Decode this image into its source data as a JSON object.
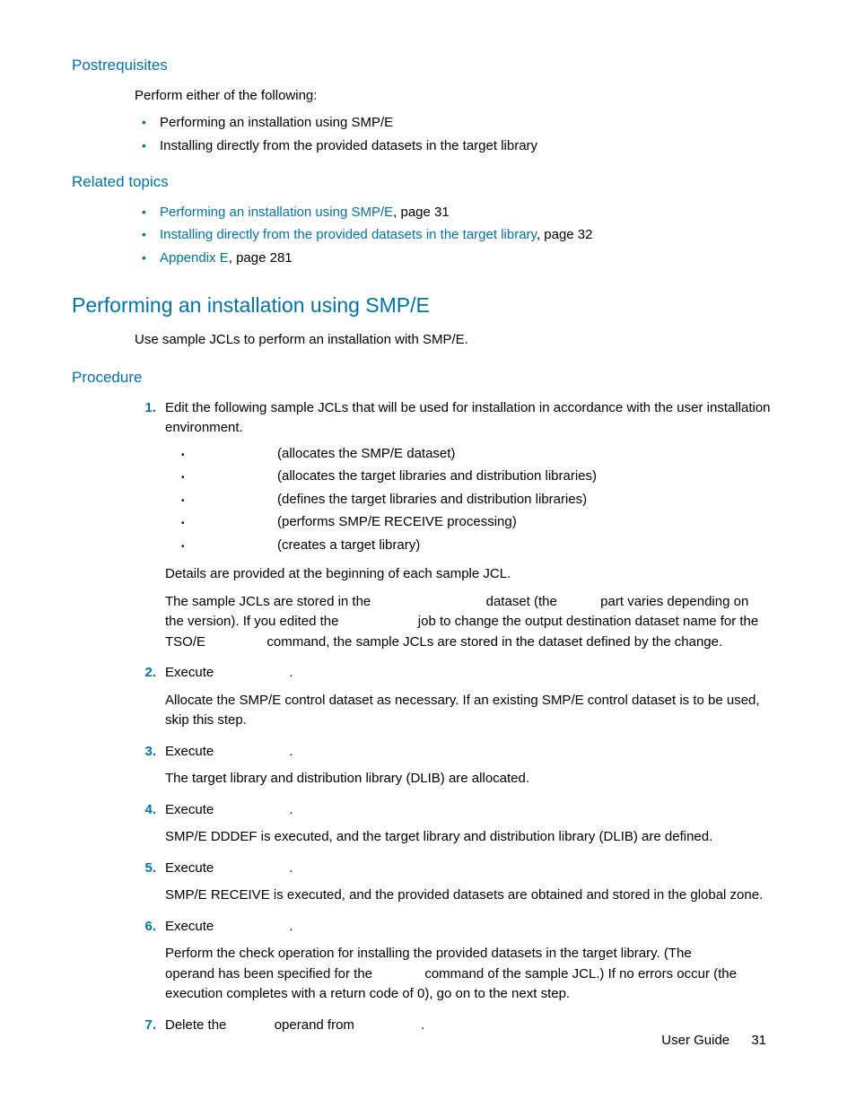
{
  "postreq": {
    "heading": "Postrequisites",
    "intro": "Perform either of the following:",
    "items": [
      "Performing an installation using SMP/E",
      "Installing directly from the provided datasets in the target library"
    ]
  },
  "related": {
    "heading": "Related topics",
    "items": [
      {
        "link": "Performing an installation using SMP/E",
        "suffix": ", page 31"
      },
      {
        "link": "Installing directly from the provided datasets in the target library",
        "suffix": ", page 32"
      },
      {
        "link": "Appendix E",
        "suffix": ", page 281"
      }
    ]
  },
  "main": {
    "heading": "Performing an installation using SMP/E",
    "intro": "Use sample JCLs to perform an installation with SMP/E."
  },
  "procedure": {
    "heading": "Procedure",
    "step1": {
      "text": "Edit the following sample JCLs that will be used for installation in accordance with the user installation environment.",
      "sub": [
        "(allocates the SMP/E dataset)",
        "(allocates the target libraries and distribution libraries)",
        "(defines the target libraries and distribution libraries)",
        "(performs SMP/E RECEIVE processing)",
        "(creates a target library)"
      ],
      "details": "Details are provided at the beginning of each sample JCL.",
      "p2a": "The sample JCLs are stored in the ",
      "p2b": " dataset (the ",
      "p2c": " part varies depending on the version). If you edited the ",
      "p2d": " job to change the output destination dataset name for the TSO/E ",
      "p2e": " command, the sample JCLs are stored in the dataset defined by the change."
    },
    "step2": {
      "exec": "Execute ",
      "dot": ".",
      "body": "Allocate the SMP/E control dataset as necessary. If an existing SMP/E control dataset is to be used, skip this step."
    },
    "step3": {
      "exec": "Execute ",
      "dot": ".",
      "body": "The target library and distribution library (DLIB) are allocated."
    },
    "step4": {
      "exec": "Execute ",
      "dot": ".",
      "body": "SMP/E DDDEF is executed, and the target library and distribution library (DLIB) are defined."
    },
    "step5": {
      "exec": "Execute ",
      "dot": ".",
      "body": "SMP/E RECEIVE is executed, and the provided datasets are obtained and stored in the global zone."
    },
    "step6": {
      "exec": "Execute ",
      "dot": ".",
      "body1": "Perform the check operation for installing the provided datasets in the target library. (The ",
      "body2": " operand has been specified for the ",
      "body3": " command of the sample JCL.) If no errors occur (the execution completes with a return code of 0), go on to the next step."
    },
    "step7": {
      "a": "Delete the ",
      "b": " operand from ",
      "c": "."
    }
  },
  "footer": {
    "label": "User Guide",
    "page": "31"
  }
}
